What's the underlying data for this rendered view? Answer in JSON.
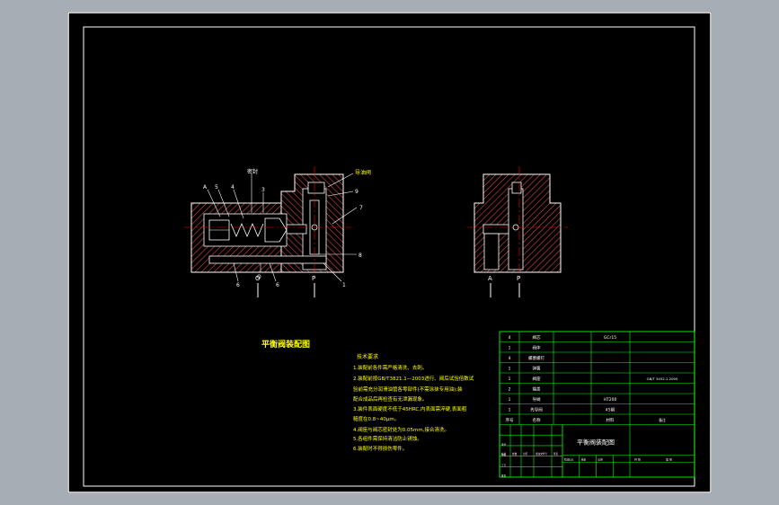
{
  "colors": {
    "frame": "#ffffff",
    "hatch": "#d94a4a",
    "center": "#ff0000",
    "title": "#ffff00",
    "table": "#00ff00",
    "sheet": "#000000",
    "workspace": "#a7adb5"
  },
  "drawing": {
    "title": "平衡阀装配图",
    "front_view": {
      "callouts_top": [
        "A",
        "5",
        "4",
        "3"
      ],
      "label_seal": "密封",
      "label_oil": "导油阀",
      "callouts_right": [
        "9",
        "7",
        "8",
        "1"
      ],
      "callouts_bottom": [
        "6",
        "O",
        "6"
      ],
      "port_labels": [
        "O",
        "P"
      ]
    },
    "side_view": {
      "port_labels": [
        "A",
        "P"
      ]
    },
    "tech_requirements": {
      "heading": "技术要求",
      "lines": [
        "1.装配前各件需严格清洗、去刺。",
        "2.装配前按GB/T3821.1—2003进行、阀后试验倍数试",
        "验前需充分润滑油管各零部件(不需涂抹专用油);装",
        "配合成品后再检查有无泄漏现象。",
        "3.装件表面硬度不低于45HRC,内表面需淬硬,表面粗",
        "糙度在0.8~40μm。",
        "4.阀座与阀芯密封处为0.05mm,接合清洗。",
        "5.各组件需保持清洁防止锈蚀。",
        "6.装配时不得损伤零件。"
      ]
    }
  },
  "title_block": {
    "drawing_name": "平衡阀装配图",
    "rows": [
      {
        "a": "4",
        "b": "阀芯",
        "c": "",
        "d": "GCr15",
        "e": "",
        "f": ""
      },
      {
        "a": "1",
        "b": "阀体",
        "c": "",
        "d": "",
        "e": "",
        "f": ""
      },
      {
        "a": "4",
        "b": "螺塞螺钉",
        "c": "",
        "d": "",
        "e": "",
        "f": ""
      },
      {
        "a": "1",
        "b": "弹簧",
        "c": "",
        "d": "",
        "e": "",
        "f": ""
      },
      {
        "a": "1",
        "b": "阀座",
        "c": "",
        "d": "",
        "e": "",
        "f": "GB/T 3452.1-2005"
      },
      {
        "a": "2",
        "b": "端盖",
        "c": "",
        "d": "",
        "e": "",
        "f": ""
      },
      {
        "a": "1",
        "b": "导阀",
        "c": "",
        "d": "HT200",
        "e": "",
        "f": ""
      },
      {
        "a": "1",
        "b": "先导阀",
        "c": "",
        "d": "45钢",
        "e": "",
        "f": ""
      },
      {
        "a": "序号",
        "b": "名称",
        "c": "",
        "d": "材料",
        "e": "",
        "f": "备注"
      }
    ],
    "bottom_cells": [
      "标记",
      "处数",
      "分区",
      "更改文件号",
      "签名",
      "年月日",
      "设计",
      "审核",
      "工艺",
      "批准",
      "阶段标记",
      "重量",
      "比例",
      "共 张",
      "第 张"
    ]
  }
}
